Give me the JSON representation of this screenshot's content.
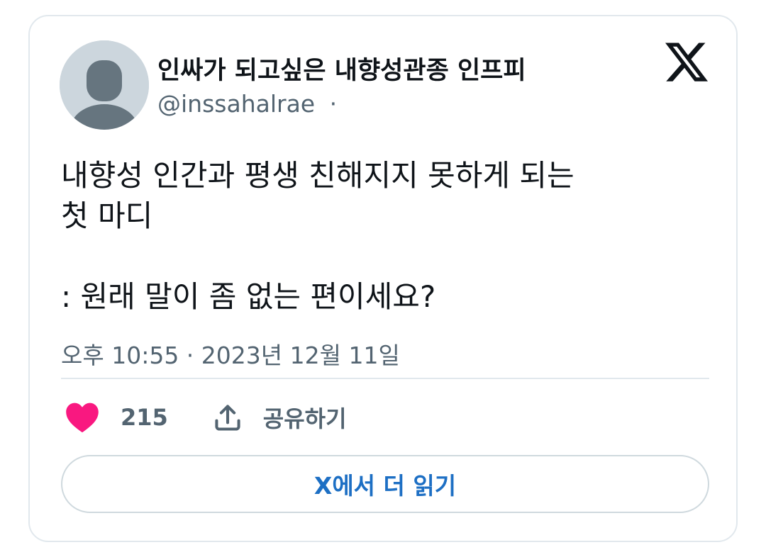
{
  "author": {
    "display_name": "인싸가 되고싶은 내향성관종 인프피",
    "handle": "@inssahalrae",
    "handle_separator": "·",
    "avatar_icon": "default-avatar-icon"
  },
  "brand": {
    "logo_icon": "x-logo-icon"
  },
  "tweet": {
    "lines": [
      "내향성 인간과 평생 친해지지 못하게 되는",
      "첫 마디",
      "",
      ": 원래 말이 좀 없는 편이세요?"
    ],
    "timestamp": "오후 10:55 · 2023년 12월 11일"
  },
  "actions": {
    "like_icon": "heart-icon",
    "like_count": "215",
    "like_color": "#f91880",
    "share_icon": "share-icon",
    "share_label": "공유하기"
  },
  "footer": {
    "read_more_label": "X에서 더 읽기",
    "read_more_color": "#1d6fc4"
  }
}
